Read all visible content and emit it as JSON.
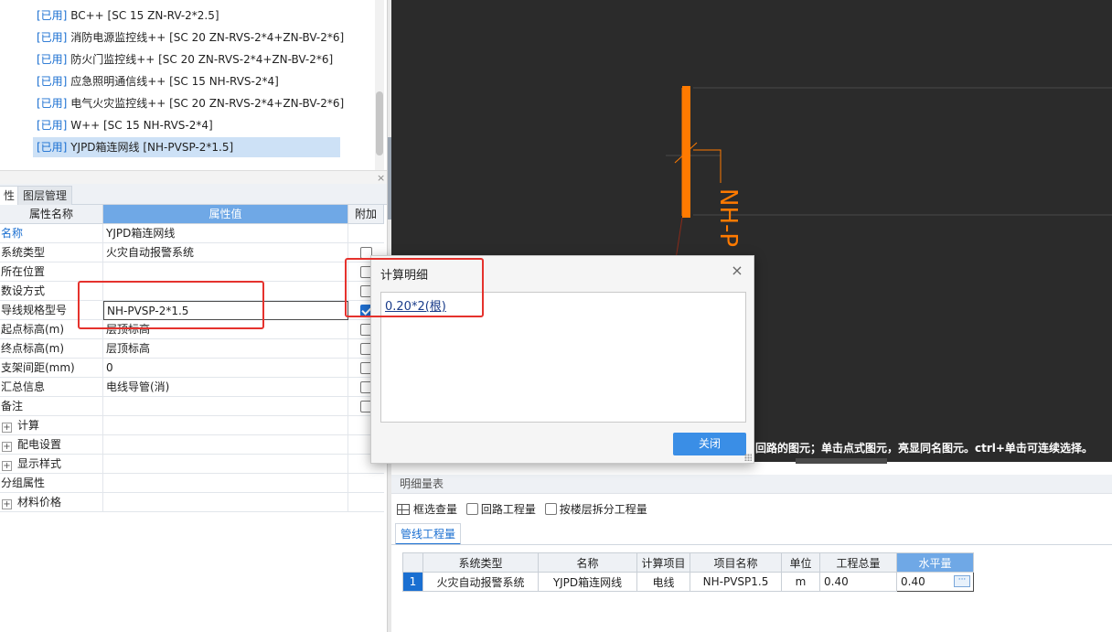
{
  "tree": {
    "used_tag": "[已用]",
    "items": [
      {
        "label": "BC++ [SC 15 ZN-RV-2*2.5]",
        "selected": false
      },
      {
        "label": "消防电源监控线++ [SC 20 ZN-RVS-2*4+ZN-BV-2*6]",
        "selected": false
      },
      {
        "label": "防火门监控线++ [SC 20 ZN-RVS-2*4+ZN-BV-2*6]",
        "selected": false
      },
      {
        "label": "应急照明通信线++ [SC 15 NH-RVS-2*4]",
        "selected": false
      },
      {
        "label": "电气火灾监控线++ [SC 20 ZN-RVS-2*4+ZN-BV-2*6]",
        "selected": false
      },
      {
        "label": "W++ [SC 15 NH-RVS-2*4]",
        "selected": false
      },
      {
        "label": "YJPD箱连网线 [NH-PVSP-2*1.5]",
        "selected": true
      }
    ]
  },
  "panel": {
    "close_icon": "×",
    "tabs": [
      "性",
      "图层管理"
    ]
  },
  "property_grid": {
    "headers": {
      "name": "属性名称",
      "value": "属性值",
      "extra": "附加"
    },
    "rows": [
      {
        "name": "名称",
        "value": "YJPD箱连网线",
        "checkbox": "none",
        "blue": true
      },
      {
        "name": "系统类型",
        "value": "火灾自动报警系统",
        "checkbox": "unchecked"
      },
      {
        "name": "所在位置",
        "value": "",
        "checkbox": "unchecked"
      },
      {
        "name": "数设方式",
        "value": "",
        "checkbox": "unchecked"
      },
      {
        "name": "导线规格型号",
        "value": "NH-PVSP-2*1.5",
        "checkbox": "checked",
        "editing": true
      },
      {
        "name": "起点标高(m)",
        "value": "层顶标高",
        "checkbox": "unchecked"
      },
      {
        "name": "终点标高(m)",
        "value": "层顶标高",
        "checkbox": "unchecked"
      },
      {
        "name": "支架间距(mm)",
        "value": "0",
        "checkbox": "unchecked"
      },
      {
        "name": "汇总信息",
        "value": "电线导管(消)",
        "checkbox": "unchecked"
      },
      {
        "name": "备注",
        "value": "",
        "checkbox": "unchecked"
      },
      {
        "name": "计算",
        "value": "",
        "checkbox": "none",
        "expander": "+"
      },
      {
        "name": "配电设置",
        "value": "",
        "checkbox": "none",
        "expander": "+"
      },
      {
        "name": "显示样式",
        "value": "",
        "checkbox": "none",
        "expander": "+"
      },
      {
        "name": "分组属性",
        "value": "",
        "checkbox": "none"
      },
      {
        "name": "材料价格",
        "value": "",
        "checkbox": "none",
        "expander": "+"
      }
    ]
  },
  "cad": {
    "background": "#2b2b2b",
    "accent": "#ff7a00",
    "vertical_label": "NH-P",
    "status_message": "回路的图元；单击点式图元，亮显同名图元。ctrl+单击可连续选择。"
  },
  "detail": {
    "title": "明细量表",
    "toolbar": {
      "select_qty": "框选查量",
      "circuit_qty": "回路工程量",
      "split_by_floor": "按楼层拆分工程量"
    },
    "tab": "管线工程量",
    "columns": [
      "系统类型",
      "名称",
      "计算项目",
      "项目名称",
      "单位",
      "工程总量",
      "水平量"
    ],
    "rows": [
      {
        "index": "1",
        "cells": [
          "火灾自动报警系统",
          "YJPD箱连网线",
          "电线",
          "NH-PVSP1.5",
          "m",
          "0.40",
          "0.40"
        ]
      }
    ],
    "dots_label": "···"
  },
  "dialog": {
    "title": "计算明细",
    "close_icon": "×",
    "formula": "0.20*2(根)",
    "ok_label": "关闭"
  }
}
